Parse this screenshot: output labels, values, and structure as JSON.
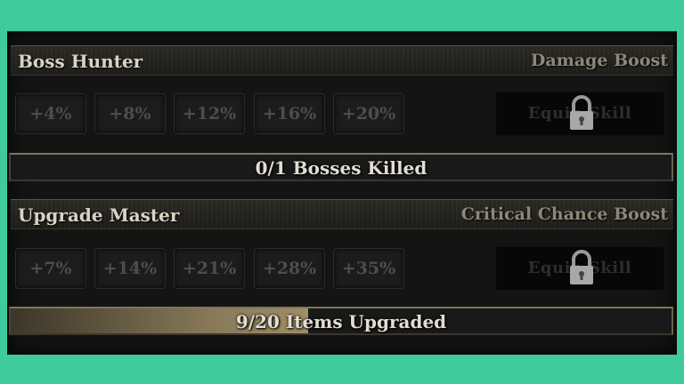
{
  "skills": [
    {
      "name": "Boss Hunter",
      "boost_type": "Damage Boost",
      "tiers": [
        "+4%",
        "+8%",
        "+12%",
        "+16%",
        "+20%"
      ],
      "equip_label": "Equip Skill",
      "locked": true,
      "progress_text": "0/1 Bosses Killed",
      "progress_fraction": 0.0
    },
    {
      "name": "Upgrade Master",
      "boost_type": "Critical Chance Boost",
      "tiers": [
        "+7%",
        "+14%",
        "+21%",
        "+28%",
        "+35%"
      ],
      "equip_label": "Equip Skill",
      "locked": true,
      "progress_text": "9/20 Items Upgraded",
      "progress_fraction": 0.45
    }
  ],
  "icons": {
    "lock": "padlock-icon"
  },
  "colors": {
    "background": "#3fcb9c",
    "panel": "#141414",
    "progress_fill": "#8a7b5a"
  }
}
